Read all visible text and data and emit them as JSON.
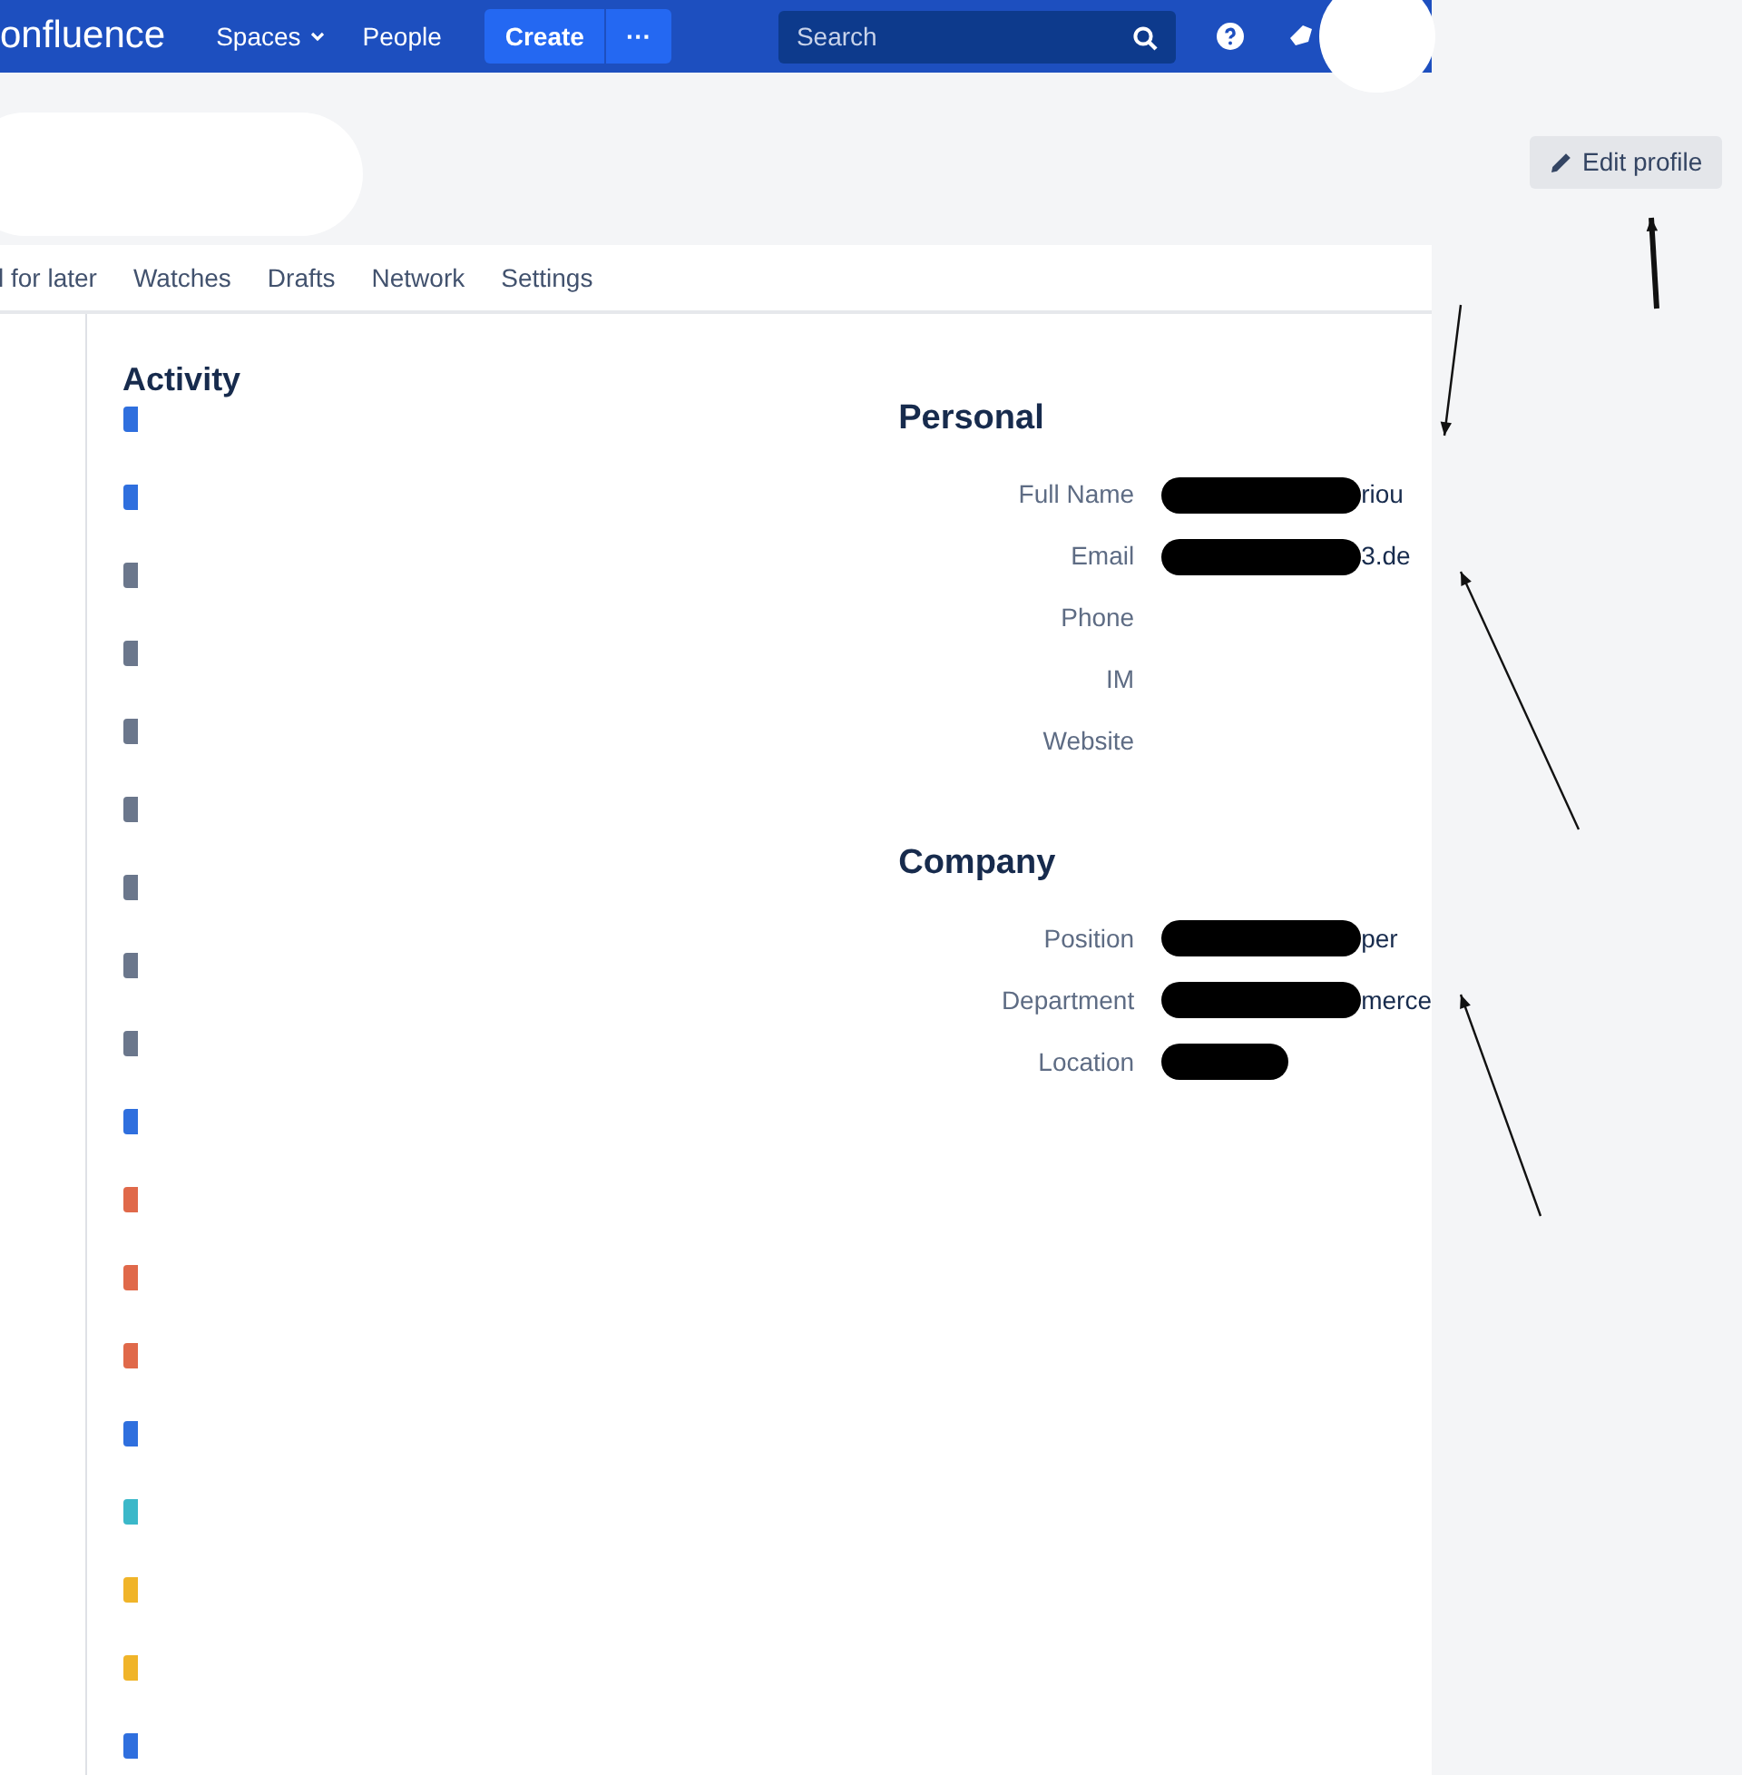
{
  "nav": {
    "logo": "onfluence",
    "items": [
      {
        "label": "Spaces",
        "dropdown": true
      },
      {
        "label": "People",
        "dropdown": false
      }
    ],
    "create": "Create",
    "more": "···",
    "search": {
      "placeholder": "Search"
    }
  },
  "edit_profile": "Edit profile",
  "tabs": [
    {
      "label": "l for later",
      "selected": false
    },
    {
      "label": "Watches",
      "selected": false
    },
    {
      "label": "Drafts",
      "selected": false
    },
    {
      "label": "Network",
      "selected": false
    },
    {
      "label": "Settings",
      "selected": false
    }
  ],
  "activity": {
    "title": "Activity",
    "items": [
      {
        "color": "#2f6fde"
      },
      {
        "color": "#2f6fde"
      },
      {
        "color": "#6b778c"
      },
      {
        "color": "#6b778c"
      },
      {
        "color": "#6b778c"
      },
      {
        "color": "#6b778c"
      },
      {
        "color": "#6b778c"
      },
      {
        "color": "#6b778c"
      },
      {
        "color": "#6b778c"
      },
      {
        "color": "#2f6fde"
      },
      {
        "color": "#e0694a"
      },
      {
        "color": "#e0694a"
      },
      {
        "color": "#e0694a"
      },
      {
        "color": "#2f6fde"
      },
      {
        "color": "#3bb8c9"
      },
      {
        "color": "#f0b429"
      },
      {
        "color": "#f0b429"
      },
      {
        "color": "#2f6fde"
      }
    ]
  },
  "sections": [
    {
      "title": "Personal",
      "fields": [
        {
          "label": "Full Name",
          "value": "riou",
          "redacted": true
        },
        {
          "label": "Email",
          "value": "3.de",
          "redacted": true
        },
        {
          "label": "Phone",
          "redacted": false
        },
        {
          "label": "IM",
          "redacted": false
        },
        {
          "label": "Website",
          "redacted": false
        }
      ]
    },
    {
      "title": "Company",
      "fields": [
        {
          "label": "Position",
          "value": "per",
          "redacted": true
        },
        {
          "label": "Department",
          "value": "merce",
          "redacted": true
        },
        {
          "label": "Location",
          "redacted": true
        }
      ]
    }
  ]
}
